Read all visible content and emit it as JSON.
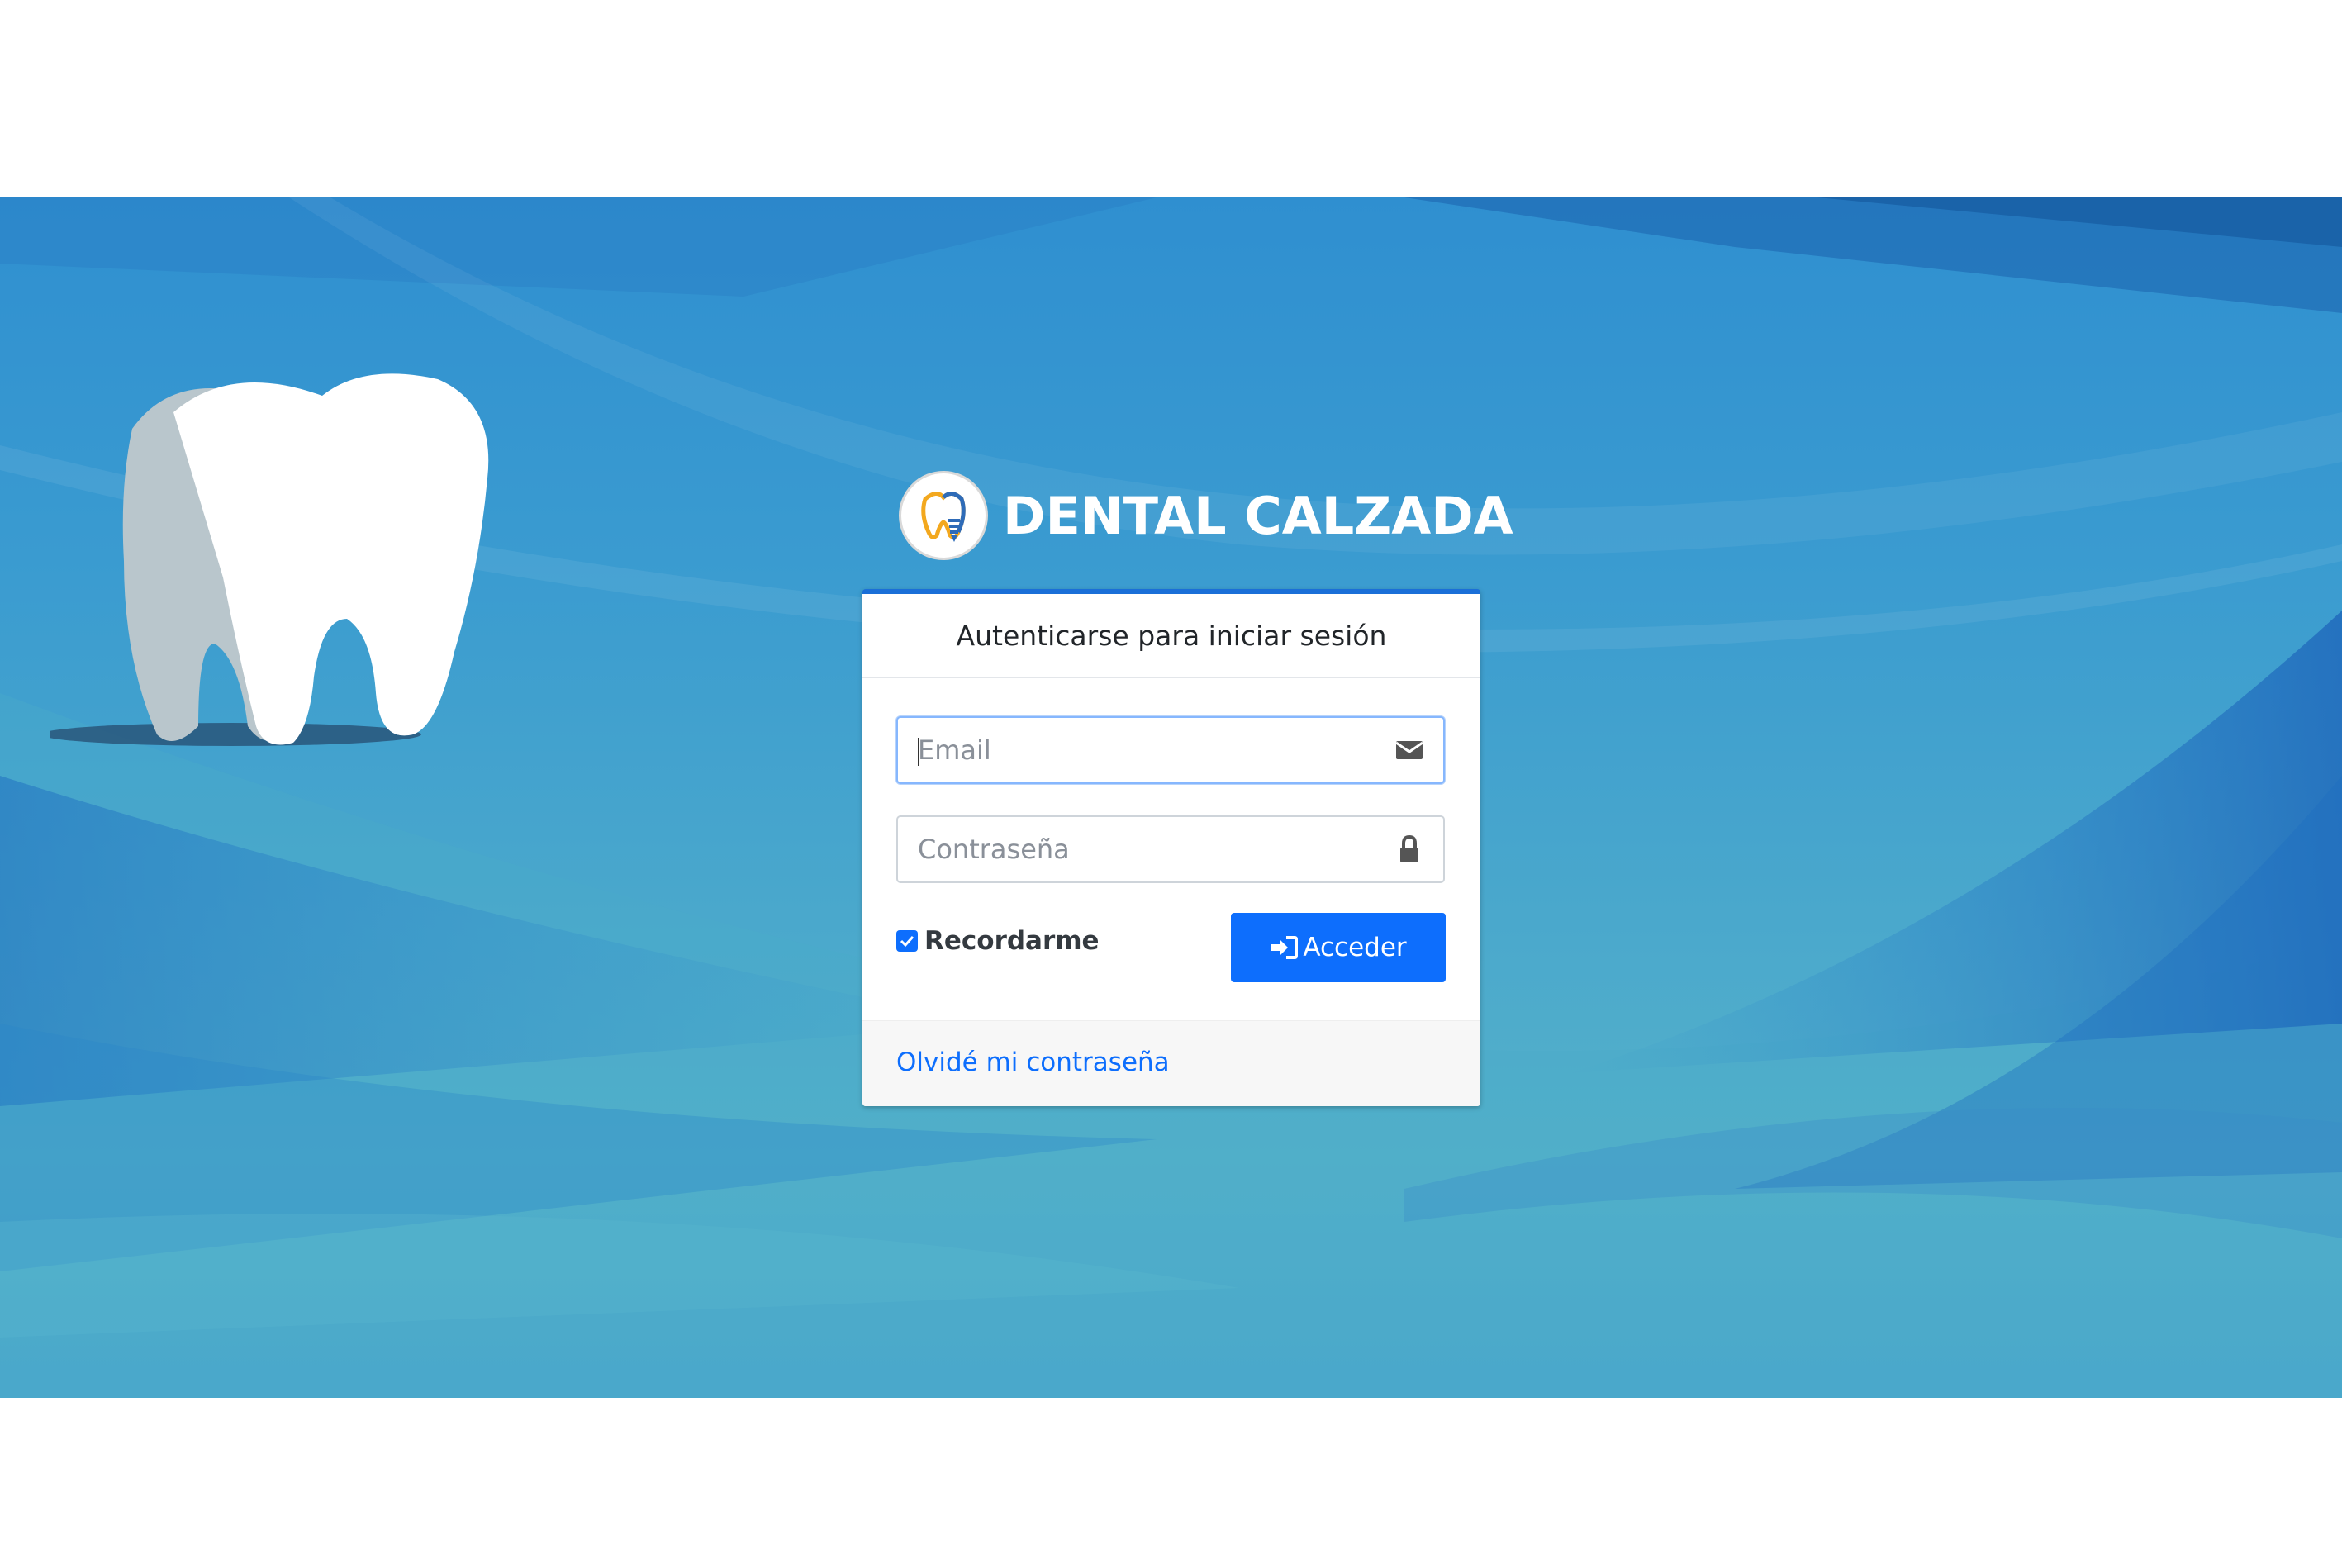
{
  "brand": {
    "name": "DENTAL CALZADA",
    "logo_icon": "tooth-logo-icon"
  },
  "login": {
    "title": "Autenticarse para iniciar sesión",
    "email": {
      "placeholder": "Email",
      "value": "",
      "icon": "envelope-icon"
    },
    "password": {
      "placeholder": "Contraseña",
      "value": "",
      "icon": "lock-icon"
    },
    "remember": {
      "label": "Recordarme",
      "checked": true
    },
    "submit": {
      "label": "Acceder",
      "icon": "sign-in-icon"
    },
    "forgot_link": "Olvidé mi contraseña"
  },
  "colors": {
    "primary": "#0d6efd",
    "card_top_border": "#1a6fd8",
    "background_blue": "#3a9bd0"
  }
}
